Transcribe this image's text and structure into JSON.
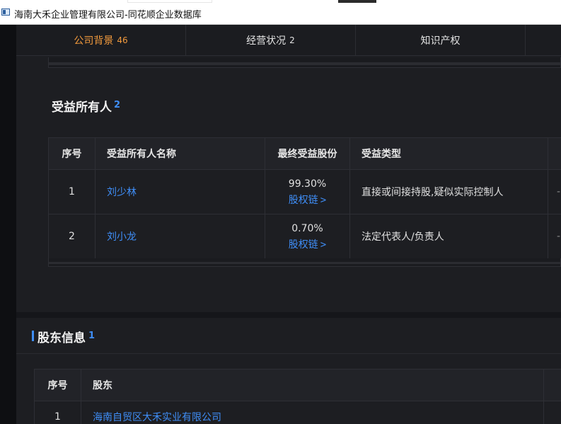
{
  "window": {
    "title": "海南大禾企业管理有限公司-同花顺企业数据库"
  },
  "tabs": [
    {
      "label": "公司背景",
      "count": "46",
      "active": true
    },
    {
      "label": "经营状况",
      "count": "2",
      "active": false
    },
    {
      "label": "知识产权",
      "count": "",
      "active": false
    }
  ],
  "beneficial": {
    "title": "受益所有人",
    "count": "2",
    "headers": {
      "idx": "序号",
      "name": "受益所有人名称",
      "share": "最终受益股份",
      "type": "受益类型"
    },
    "rows": [
      {
        "idx": "1",
        "name": "刘少林",
        "share": "99.30%",
        "chain": "股权链",
        "type": "直接或间接持股,疑似实际控制人",
        "extra": "-"
      },
      {
        "idx": "2",
        "name": "刘小龙",
        "share": "0.70%",
        "chain": "股权链",
        "type": "法定代表人/负责人",
        "extra": "-"
      }
    ]
  },
  "shareholders": {
    "title": "股东信息",
    "count": "1",
    "headers": {
      "idx": "序号",
      "name": "股东"
    },
    "rows": [
      {
        "idx": "1",
        "name": "海南自贸区大禾实业有限公司"
      }
    ]
  },
  "colors": {
    "accent": "#3f8ef7",
    "active_tab": "#f29a3d",
    "background": "#1d1e22"
  }
}
